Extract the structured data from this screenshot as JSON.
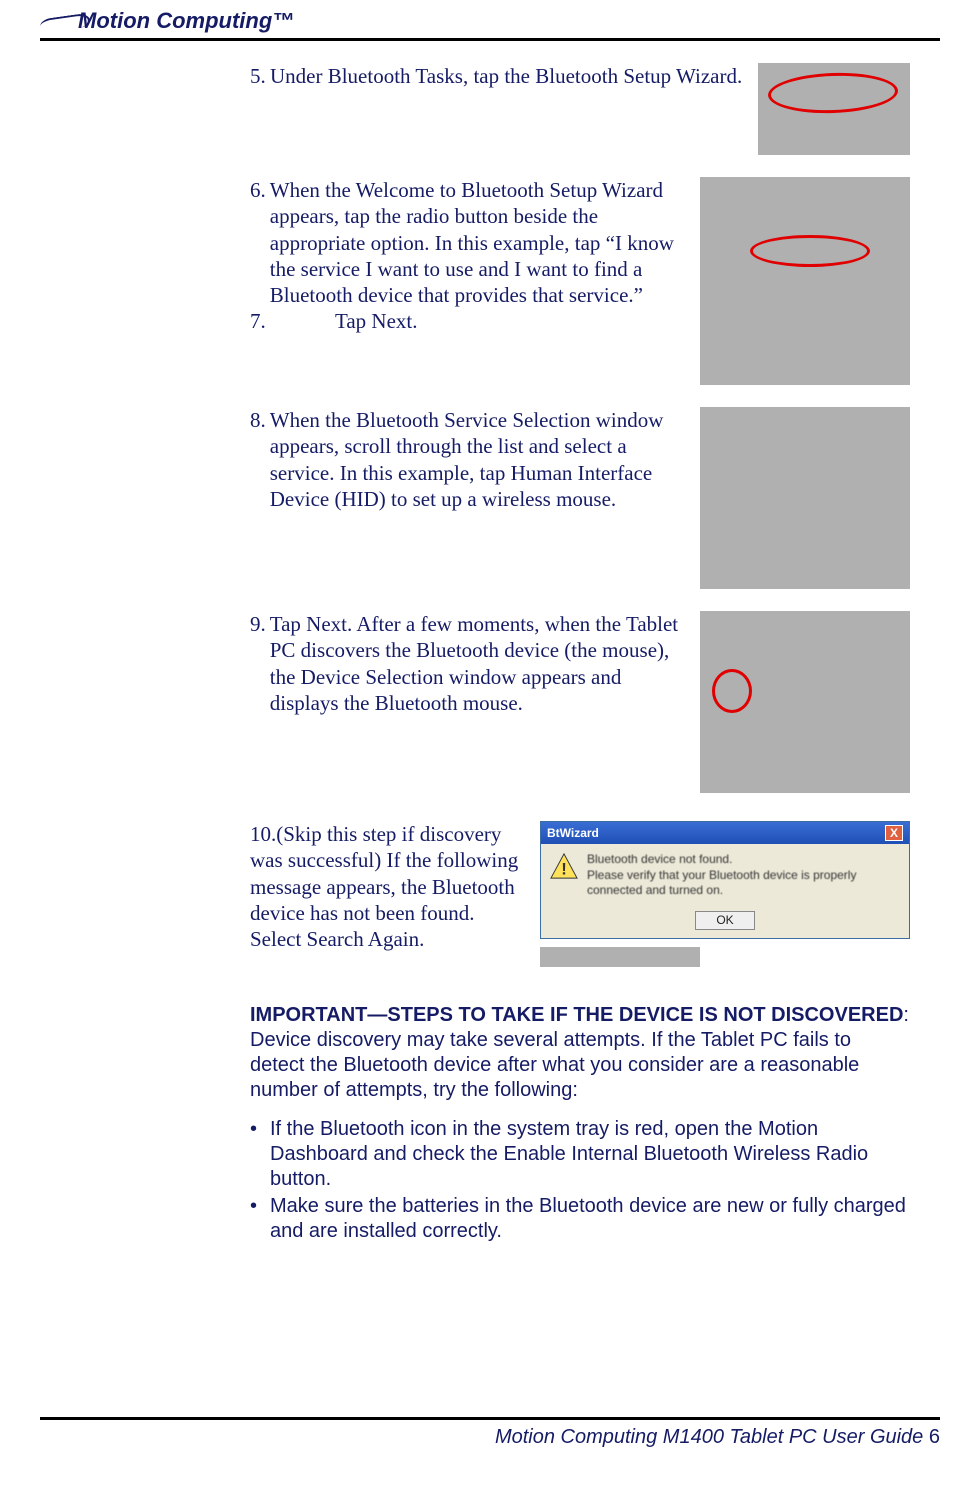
{
  "header": {
    "logo_text": "Motion Computing"
  },
  "steps": {
    "s5": {
      "num": "5.",
      "text": "Under Bluetooth Tasks, tap the Bluetooth Setup Wizard."
    },
    "s6": {
      "num": "6.",
      "text": "When the Welcome to Bluetooth Setup Wizard appears, tap the radio button beside the appropriate option. In this example, tap “I know the service I want to use and I want to find a Bluetooth device that provides that service.”"
    },
    "s7": {
      "num": "7.",
      "text": "Tap Next."
    },
    "s8": {
      "num": "8.",
      "text": "When the Bluetooth Service Selection window appears, scroll through the list and select a service. In this example, tap Human Interface Device (HID) to set up a wireless mouse."
    },
    "s9": {
      "num": "9.",
      "text": "Tap Next. After a few moments, when the Tablet PC discovers the Bluetooth device (the mouse), the Device Selection win­dow appears and displays the Bluetooth mouse."
    },
    "s10": {
      "num": "10.",
      "text": "(Skip this step if discovery was successful) If the fol­lowing message appears, the Bluetooth device has not been found. Select Search Again."
    }
  },
  "dialog": {
    "title": "BtWizard",
    "line1": "Bluetooth device not found.",
    "line2": "Please verify that your Bluetooth device is properly connected and turned on.",
    "ok": "OK",
    "close": "X"
  },
  "important": {
    "heading": "IMPORTANT—STEPS TO TAKE IF THE DEVICE IS NOT DISCOVERED",
    "intro": ": Device discovery may take several attempts. If the Tablet PC fails to detect the Bluetooth device after what you consider are a reasonable number of attempts, try the following:",
    "b1": "If the Bluetooth icon in the system tray is red, open the Motion Dashboard and check the Enable Internal Bluetooth Wireless Radio button.",
    "b2": "Make sure the batteries in the Bluetooth device are new or fully charged and are installed correctly."
  },
  "footer": {
    "text": "Motion Computing M1400 Tablet PC User Guide",
    "page": "6"
  }
}
